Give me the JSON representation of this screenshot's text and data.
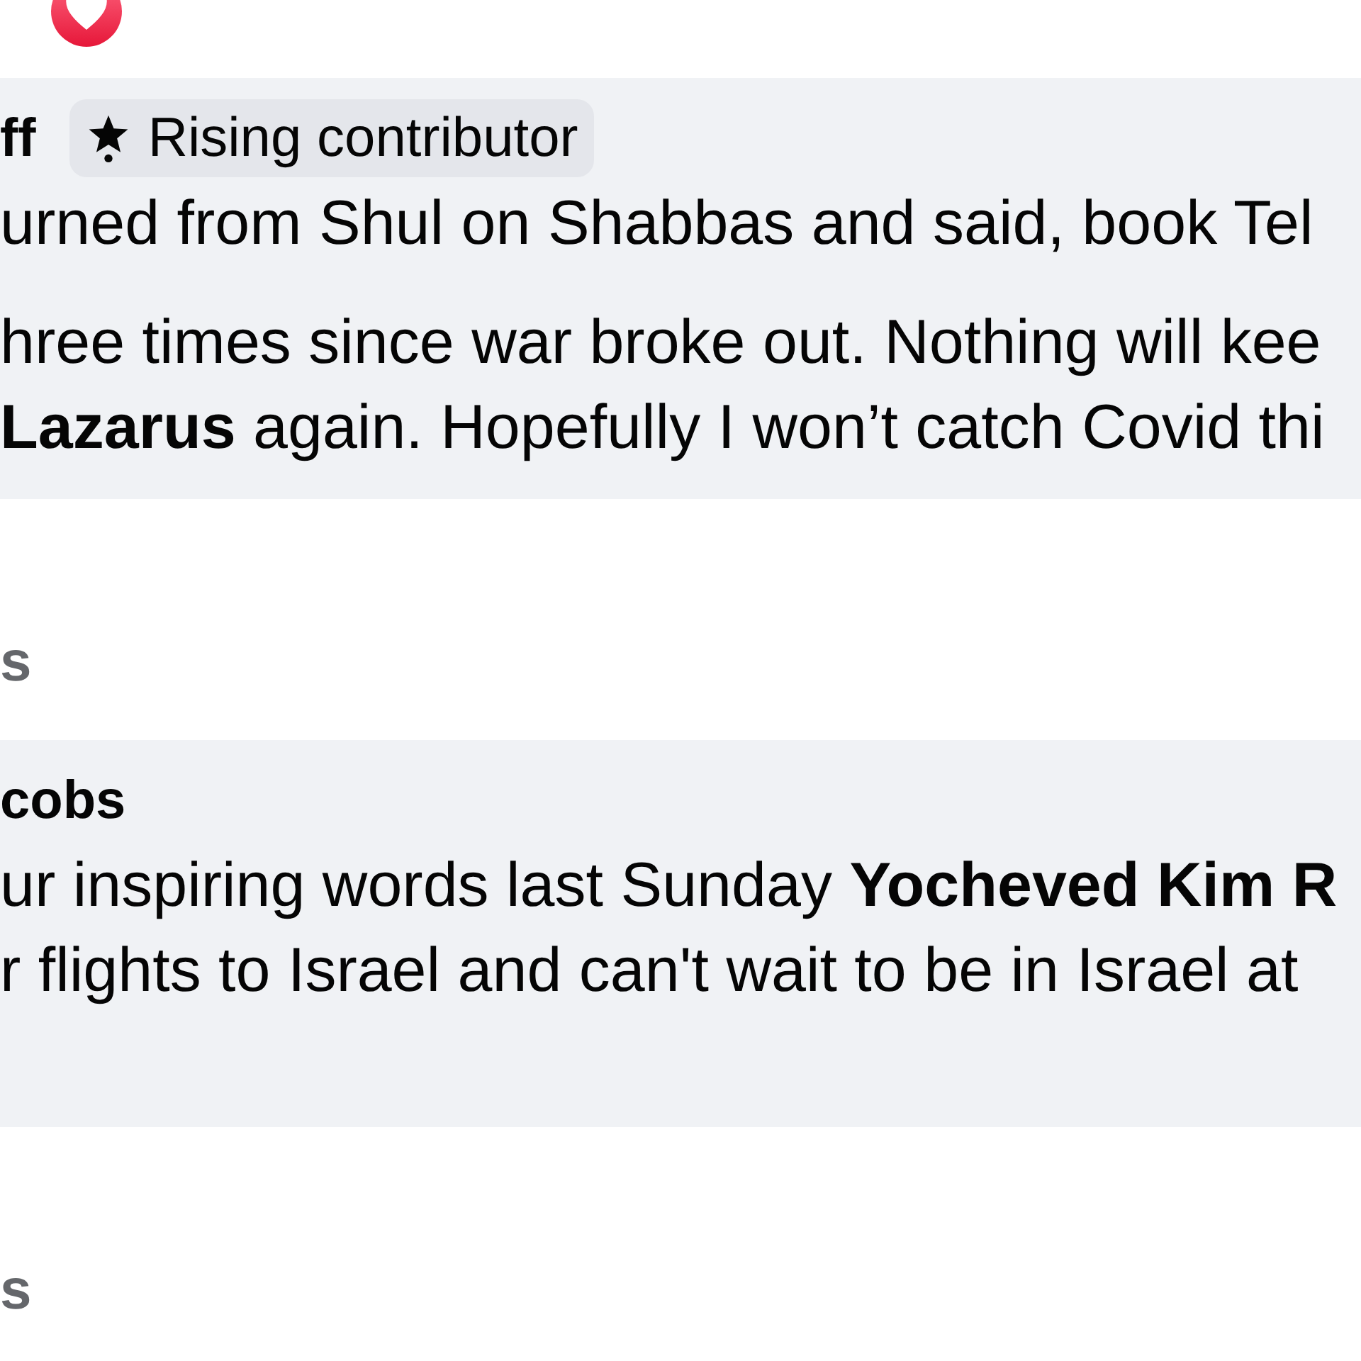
{
  "comments": [
    {
      "author": "ff",
      "badge": "Rising contributor",
      "paragraphs": [
        {
          "lines": [
            "urned from Shul on Shabbas and said, book Tel"
          ]
        },
        {
          "lines": [
            "hree times since war broke out. Nothing will kee",
            "**Lazarus** again. Hopefully I won’t catch Covid thi"
          ]
        }
      ],
      "action": "s"
    },
    {
      "author": "cobs",
      "paragraphs": [
        {
          "lines": [
            "ur inspiring words last Sunday **Yocheved Kim R**",
            "r flights to Israel and can't wait to be in Israel at"
          ]
        }
      ],
      "action": "s"
    }
  ]
}
